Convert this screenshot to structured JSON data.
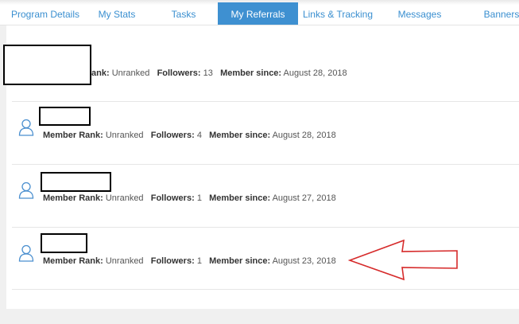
{
  "tabs": [
    {
      "label": "Program Details",
      "active": false
    },
    {
      "label": "My Stats",
      "active": false
    },
    {
      "label": "Tasks",
      "active": false
    },
    {
      "label": "My Referrals",
      "active": true
    },
    {
      "label": "Links & Tracking",
      "active": false
    },
    {
      "label": "Messages",
      "active": false
    },
    {
      "label": "Banners",
      "active": false
    }
  ],
  "labels": {
    "rank": "Member Rank:",
    "rank_short": "ank:",
    "followers": "Followers:",
    "since": "Member since:"
  },
  "referrals": [
    {
      "rank": "Unranked",
      "followers": "13",
      "since": "August 28, 2018"
    },
    {
      "rank": "Unranked",
      "followers": "4",
      "since": "August 28, 2018"
    },
    {
      "rank": "Unranked",
      "followers": "1",
      "since": "August 27, 2018"
    },
    {
      "rank": "Unranked",
      "followers": "1",
      "since": "August 23, 2018"
    }
  ],
  "colors": {
    "accent": "#3e90d1",
    "link": "#3a8fd0",
    "annotation_arrow": "#d62b2b"
  },
  "icons": [
    "user-icon"
  ]
}
